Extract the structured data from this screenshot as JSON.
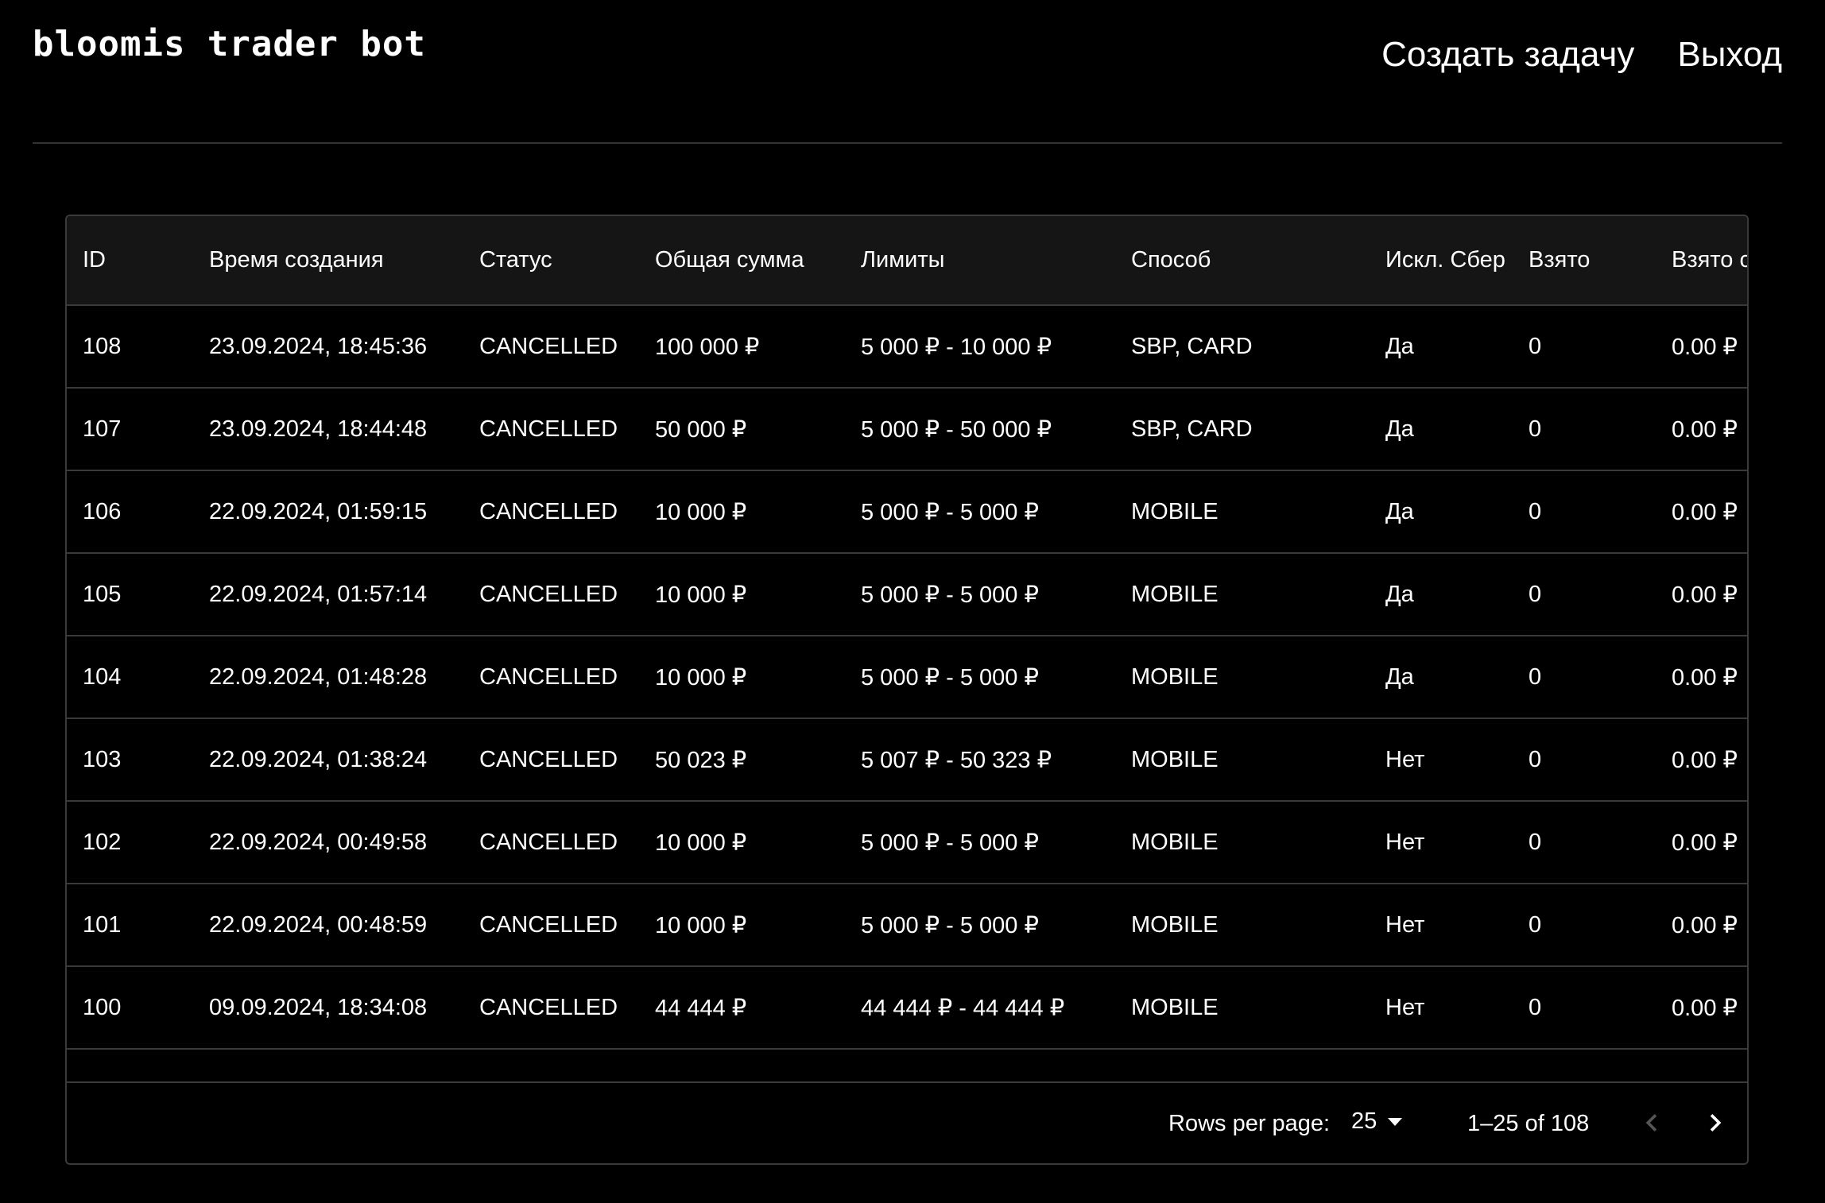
{
  "header": {
    "logo": "bloomis trader bot",
    "nav": {
      "create_task": "Создать задачу",
      "logout": "Выход"
    }
  },
  "table": {
    "columns": [
      "ID",
      "Время создания",
      "Статус",
      "Общая сумма",
      "Лимиты",
      "Способ",
      "Искл. Сбер",
      "Взято",
      "Взято с"
    ],
    "rows": [
      [
        "108",
        "23.09.2024, 18:45:36",
        "CANCELLED",
        "100 000 ₽",
        "5 000 ₽ - 10 000 ₽",
        "SBP, CARD",
        "Да",
        "0",
        "0.00 ₽"
      ],
      [
        "107",
        "23.09.2024, 18:44:48",
        "CANCELLED",
        "50 000 ₽",
        "5 000 ₽ - 50 000 ₽",
        "SBP, CARD",
        "Да",
        "0",
        "0.00 ₽"
      ],
      [
        "106",
        "22.09.2024, 01:59:15",
        "CANCELLED",
        "10 000 ₽",
        "5 000 ₽ - 5 000 ₽",
        "MOBILE",
        "Да",
        "0",
        "0.00 ₽"
      ],
      [
        "105",
        "22.09.2024, 01:57:14",
        "CANCELLED",
        "10 000 ₽",
        "5 000 ₽ - 5 000 ₽",
        "MOBILE",
        "Да",
        "0",
        "0.00 ₽"
      ],
      [
        "104",
        "22.09.2024, 01:48:28",
        "CANCELLED",
        "10 000 ₽",
        "5 000 ₽ - 5 000 ₽",
        "MOBILE",
        "Да",
        "0",
        "0.00 ₽"
      ],
      [
        "103",
        "22.09.2024, 01:38:24",
        "CANCELLED",
        "50 023 ₽",
        "5 007 ₽ - 50 323 ₽",
        "MOBILE",
        "Нет",
        "0",
        "0.00 ₽"
      ],
      [
        "102",
        "22.09.2024, 00:49:58",
        "CANCELLED",
        "10 000 ₽",
        "5 000 ₽ - 5 000 ₽",
        "MOBILE",
        "Нет",
        "0",
        "0.00 ₽"
      ],
      [
        "101",
        "22.09.2024, 00:48:59",
        "CANCELLED",
        "10 000 ₽",
        "5 000 ₽ - 5 000 ₽",
        "MOBILE",
        "Нет",
        "0",
        "0.00 ₽"
      ],
      [
        "100",
        "09.09.2024, 18:34:08",
        "CANCELLED",
        "44 444 ₽",
        "44 444 ₽ - 44 444 ₽",
        "MOBILE",
        "Нет",
        "0",
        "0.00 ₽"
      ]
    ]
  },
  "pagination": {
    "rows_per_page_label": "Rows per page:",
    "rows_per_page_value": "25",
    "range_text": "1–25 of 108",
    "prev_icon": "chevron-left-icon",
    "next_icon": "chevron-right-icon"
  },
  "colors": {
    "background": "#000000",
    "text": "#ffffff",
    "divider": "#3a3a3a",
    "header_row": "#151515",
    "disabled": "#555555"
  }
}
